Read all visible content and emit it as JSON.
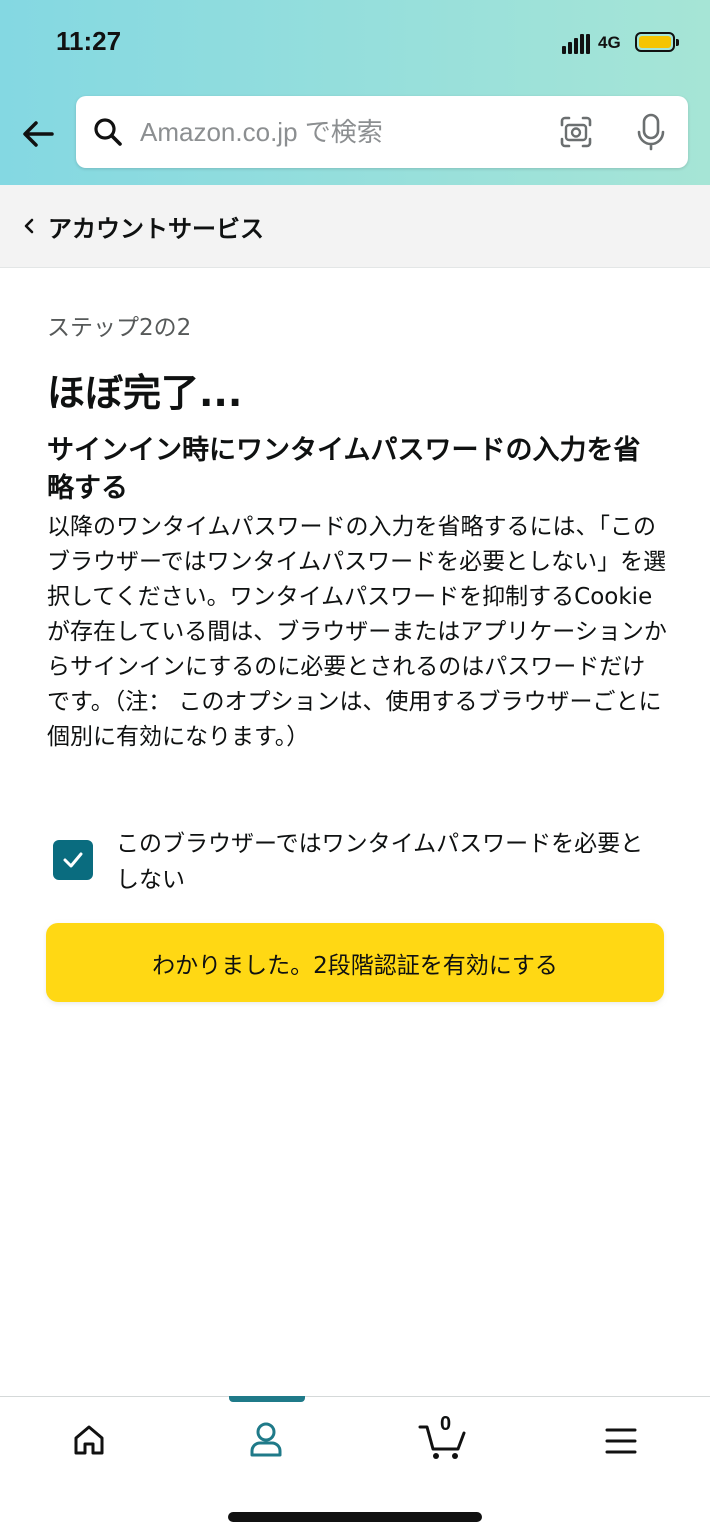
{
  "status_bar": {
    "time": "11:27",
    "network": "4G"
  },
  "search": {
    "placeholder": "Amazon.co.jp で検索",
    "value": ""
  },
  "subnav": {
    "label": "アカウントサービス"
  },
  "main": {
    "step": "ステップ2の2",
    "title": "ほぼ完了...",
    "section_title": "サインイン時にワンタイムパスワードの入力を省略する",
    "description": "以降のワンタイムパスワードの入力を省略するには、「このブラウザーではワンタイムパスワードを必要としない」を選択してください。ワンタイムパスワードを抑制するCookieが存在している間は、ブラウザーまたはアプリケーションからサインインにするのに必要とされるのはパスワードだけです。（注： このオプションは、使用するブラウザーごとに個別に有効になります。）",
    "checkbox_label": "このブラウザーではワンタイムパスワードを必要としない",
    "checkbox_checked": true,
    "button_label": "わかりました。2段階認証を有効にする"
  },
  "bottom_nav": {
    "items": [
      {
        "icon": "home-icon"
      },
      {
        "icon": "account-icon",
        "active": true
      },
      {
        "icon": "cart-icon"
      },
      {
        "icon": "menu-icon"
      }
    ],
    "cart_count": "0"
  },
  "colors": {
    "header_gradient_start": "#84d8e2",
    "header_gradient_end": "#a6e5d6",
    "checkbox": "#0a6c7f",
    "button": "#ffd814",
    "active_tab": "#1f7a89"
  }
}
